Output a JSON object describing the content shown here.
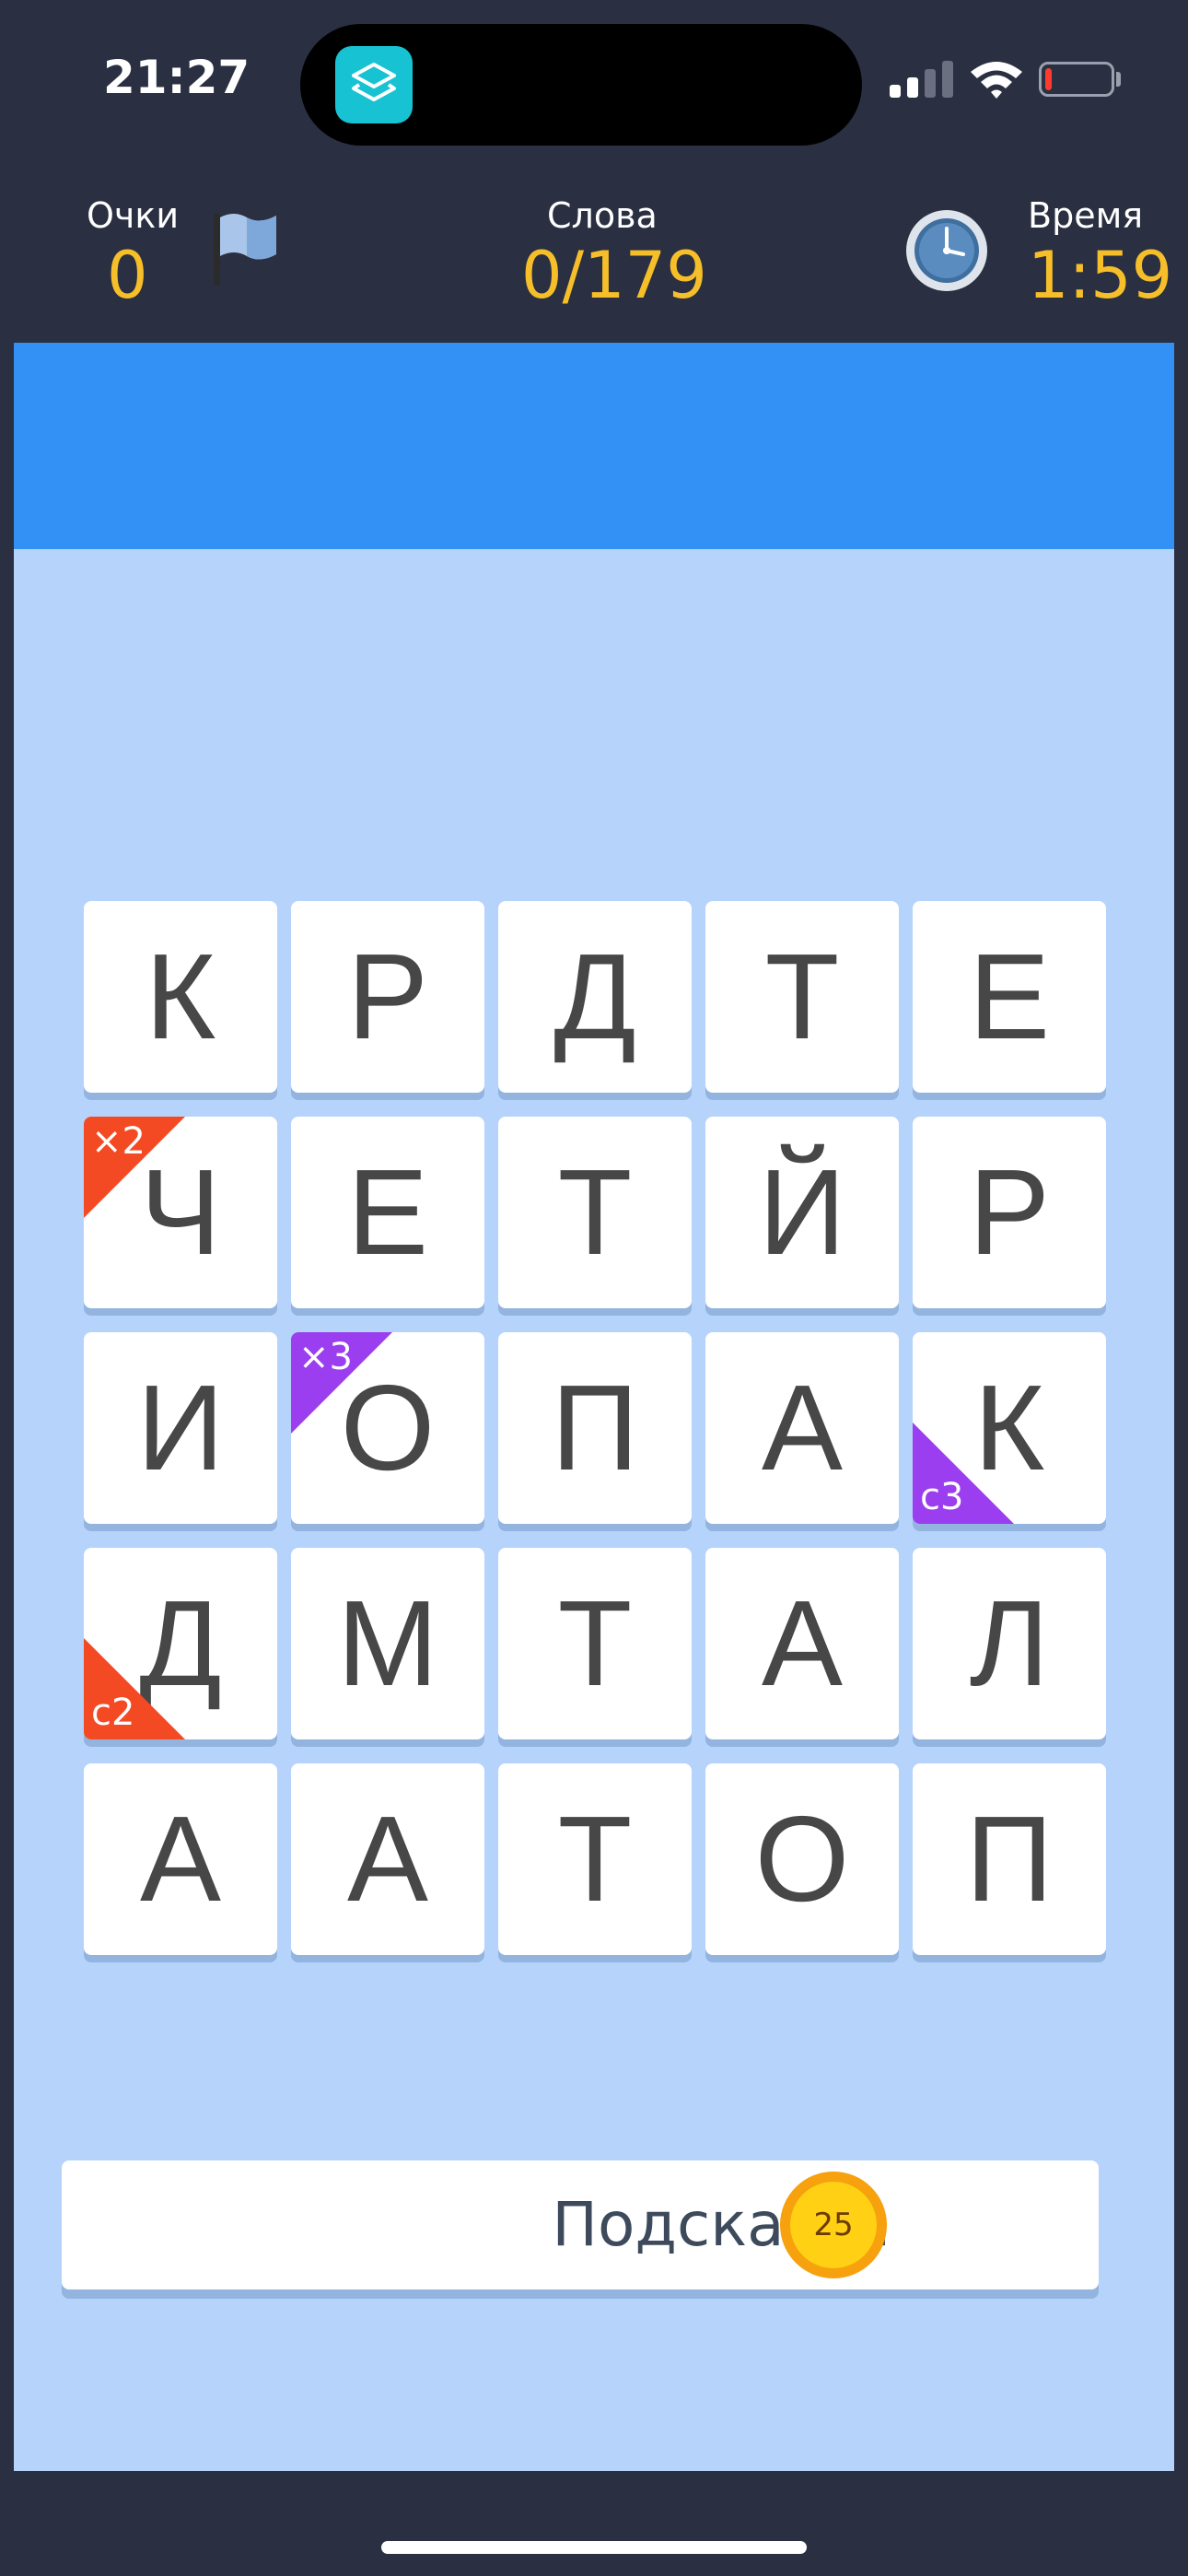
{
  "status_bar": {
    "time": "21:27",
    "island_app_icon": "stack-icon",
    "battery_level": 0.1
  },
  "header": {
    "score_label": "Очки",
    "score_value": "0",
    "words_label": "Слова",
    "words_value": "0/179",
    "time_label": "Время",
    "time_value": "1:59",
    "flag_icon": "flag-icon",
    "clock_icon": "clock-icon"
  },
  "colors": {
    "background": "#2a2f41",
    "accent_value": "#f6bf2a",
    "word_band": "#3390f4",
    "board": "#b6d3fb",
    "badge_red": "#f44a24",
    "badge_purple": "#9b3ef0",
    "coin": "#ffd014"
  },
  "grid": {
    "rows": [
      [
        {
          "letter": "К"
        },
        {
          "letter": "Р"
        },
        {
          "letter": "Д"
        },
        {
          "letter": "Т"
        },
        {
          "letter": "Е"
        }
      ],
      [
        {
          "letter": "Ч",
          "badge": "×2",
          "badge_color": "red",
          "corner": "tl"
        },
        {
          "letter": "Е"
        },
        {
          "letter": "Т"
        },
        {
          "letter": "Й"
        },
        {
          "letter": "Р"
        }
      ],
      [
        {
          "letter": "И"
        },
        {
          "letter": "О",
          "badge": "×3",
          "badge_color": "purple",
          "corner": "tl"
        },
        {
          "letter": "П"
        },
        {
          "letter": "А"
        },
        {
          "letter": "К",
          "badge": "с3",
          "badge_color": "purple",
          "corner": "bl"
        }
      ],
      [
        {
          "letter": "Д",
          "badge": "с2",
          "badge_color": "red",
          "corner": "bl"
        },
        {
          "letter": "М"
        },
        {
          "letter": "Т"
        },
        {
          "letter": "А"
        },
        {
          "letter": "Л"
        }
      ],
      [
        {
          "letter": "А"
        },
        {
          "letter": "А"
        },
        {
          "letter": "Т"
        },
        {
          "letter": "О"
        },
        {
          "letter": "П"
        }
      ]
    ]
  },
  "hint": {
    "label": "Подсказка",
    "cost": "25"
  }
}
